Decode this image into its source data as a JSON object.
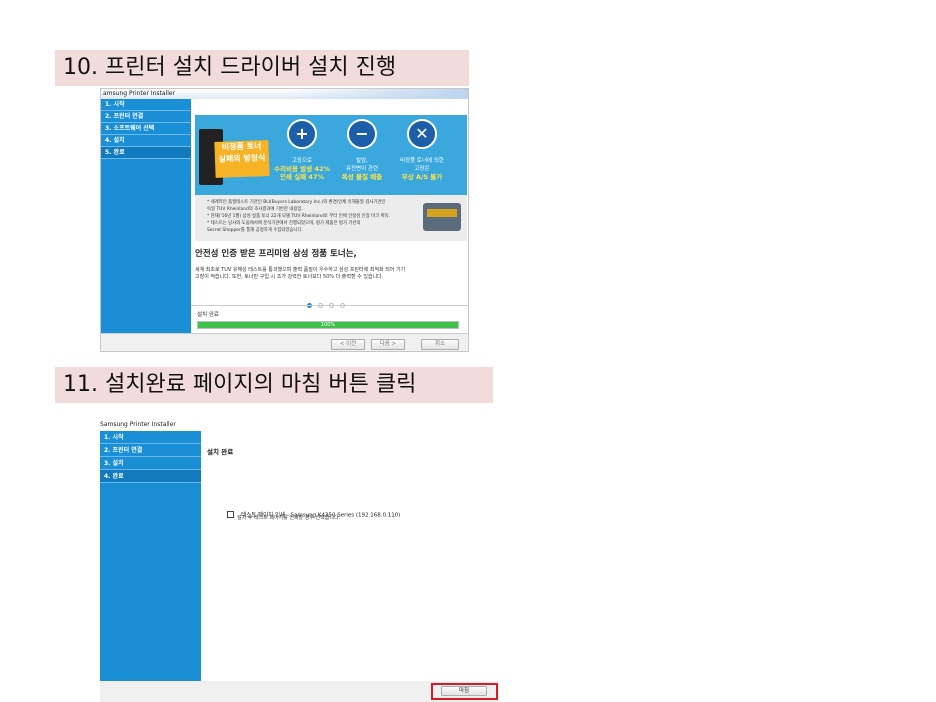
{
  "steps": [
    {
      "label": "10. 프린터 설치 드라이버 설치 진행"
    },
    {
      "label": "11. 설치완료 페이지의 마침 버튼 클릭"
    }
  ],
  "window1": {
    "title": "amsung Printer Installer",
    "sidebar": [
      "1. 시작",
      "2. 프린터 연결",
      "3. 소프트웨어 선택",
      "4. 설치",
      "5. 완료"
    ],
    "banner": {
      "label_line1": "비정품 토너",
      "label_line2": "실패의 방정식",
      "col1_line1": "고장으로",
      "col1_line2": "수리비용 발생 42%",
      "col1_line3": "인쇄 실패 47%",
      "col2_line1": "발암,",
      "col2_line2": "유전변이 관련",
      "col2_line3": "독성 물질 배출",
      "col3_line1": "비정품 토너에 의한",
      "col3_line2": "고장은",
      "col3_line3": "무상 A/S 불가",
      "note1": "* 세계적인 품질테스트 기관인 BLI(Buyers Laboratory Inc.)와 환경/인체 유해물질 검사기관인",
      "note2": "독일 TUV Rheinland의 조사결과에 기반한 내용임.",
      "note3": "* 현재('16년 1월) 삼성 정품 토너 22개 모델 TUV Rheinland로 부터 인체 안정성 인증 마크 획득.",
      "note4": "* 테스트는 당사와 도움에서에 분석기관에서 진행되었으며, 평가 제품은 평가 기관의",
      "note5": "Secret Shopper를 통해 공정하게 수집되었습니다."
    },
    "headline": "안전성 인증 받은 프리미엄 삼성 정품 토너는,",
    "body_line1": "세계 최초로 TUV 유해성 테스트를 통과했으며 출력 품질이 우수하고 삼성 프린터에 최적화 되어 기기",
    "body_line2": "고장이 적습니다. 또한, 토너만 구입 시 조가 강력한 토너보다 50% 더 출력할 수 있습니다.",
    "status": "설치 완료",
    "progress_percent": 100,
    "progress_label": "100%",
    "buttons": {
      "prev": "< 이전",
      "next": "다음 >",
      "cancel": "취소"
    }
  },
  "window2": {
    "title": "Samsung Printer Installer",
    "sidebar": [
      "1. 시작",
      "2. 프린터 연결",
      "3. 설치",
      "4. 완료"
    ],
    "heading": "설치 완료",
    "checkbox_label": "테스트 페이지 인쇄 - Samsung K4350 Series (192.168.0.110)",
    "checkbox_desc": "설치 후 테스트 페이지를 인쇄할 경우 선택합니다.",
    "finish_button": "마침"
  },
  "colors": {
    "sidebar": "#1a8fd6",
    "highlight": "#d81b27",
    "progress": "#3fc24b",
    "step_banner": "#f2dcdb"
  }
}
